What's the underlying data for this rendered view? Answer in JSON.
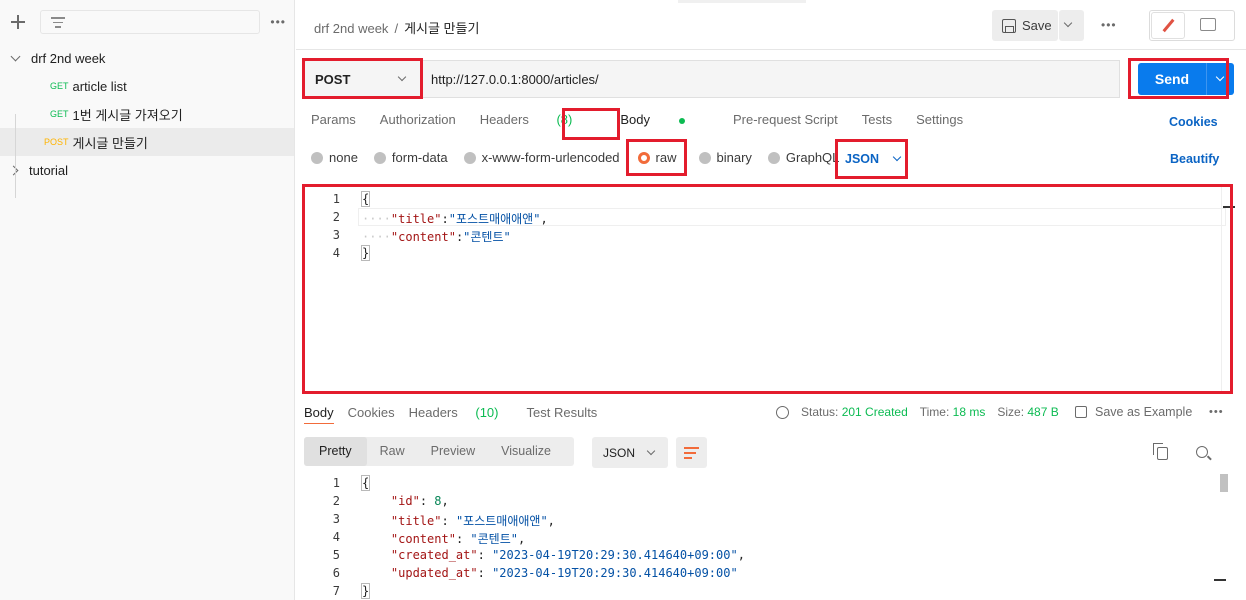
{
  "sidebar": {
    "more_label": "•••",
    "collections": [
      {
        "name": "drf 2nd week",
        "expanded": true,
        "requests": [
          {
            "method": "GET",
            "name": "article list"
          },
          {
            "method": "GET",
            "name": "1번 게시글 가져오기"
          },
          {
            "method": "POST",
            "name": "게시글 만들기"
          }
        ]
      },
      {
        "name": "tutorial",
        "expanded": false
      }
    ]
  },
  "header": {
    "breadcrumb_collection": "drf 2nd week",
    "breadcrumb_separator": "/",
    "breadcrumb_request": "게시글 만들기",
    "save_label": "Save",
    "more_label": "•••"
  },
  "request": {
    "method": "POST",
    "url": "http://127.0.0.1:8000/articles/",
    "send_label": "Send",
    "tabs": [
      {
        "label": "Params"
      },
      {
        "label": "Authorization"
      },
      {
        "label": "Headers",
        "count": "(8)"
      },
      {
        "label": "Body"
      },
      {
        "label": "Pre-request Script"
      },
      {
        "label": "Tests"
      },
      {
        "label": "Settings"
      }
    ],
    "cookies_label": "Cookies",
    "body_types": [
      "none",
      "form-data",
      "x-www-form-urlencoded",
      "raw",
      "binary",
      "GraphQL"
    ],
    "selected_body_type": "raw",
    "format": "JSON",
    "beautify_label": "Beautify",
    "body_lines": [
      {
        "n": "1",
        "text": "{"
      },
      {
        "n": "2",
        "key": "\"title\"",
        "value": "\"포스트매애애앤\"",
        "trail": ","
      },
      {
        "n": "3",
        "key": "\"content\"",
        "value": "\"콘텐트\"",
        "trail": ""
      },
      {
        "n": "4",
        "text": "}"
      }
    ]
  },
  "response": {
    "tabs": [
      {
        "label": "Body"
      },
      {
        "label": "Cookies"
      },
      {
        "label": "Headers",
        "count": "(10)"
      },
      {
        "label": "Test Results"
      }
    ],
    "status_label": "Status:",
    "status_value": "201 Created",
    "time_label": "Time:",
    "time_value": "18 ms",
    "size_label": "Size:",
    "size_value": "487 B",
    "save_example_label": "Save as Example",
    "more_label": "•••",
    "views": [
      "Pretty",
      "Raw",
      "Preview",
      "Visualize"
    ],
    "format": "JSON",
    "lines": [
      {
        "n": "1",
        "text": "{"
      },
      {
        "n": "2",
        "key": "\"id\"",
        "value": "8",
        "trail": ",",
        "num": true
      },
      {
        "n": "3",
        "key": "\"title\"",
        "value": "\"포스트매애애앤\"",
        "trail": ","
      },
      {
        "n": "4",
        "key": "\"content\"",
        "value": "\"콘텐트\"",
        "trail": ","
      },
      {
        "n": "5",
        "key": "\"created_at\"",
        "value": "\"2023-04-19T20:29:30.414640+09:00\"",
        "trail": ","
      },
      {
        "n": "6",
        "key": "\"updated_at\"",
        "value": "\"2023-04-19T20:29:30.414640+09:00\"",
        "trail": ""
      },
      {
        "n": "7",
        "text": "}"
      }
    ]
  },
  "colors": {
    "accent_blue": "#097bed",
    "get_green": "#0cbb52",
    "post_orange": "#ffb400",
    "highlight_red": "#e31c2d"
  }
}
